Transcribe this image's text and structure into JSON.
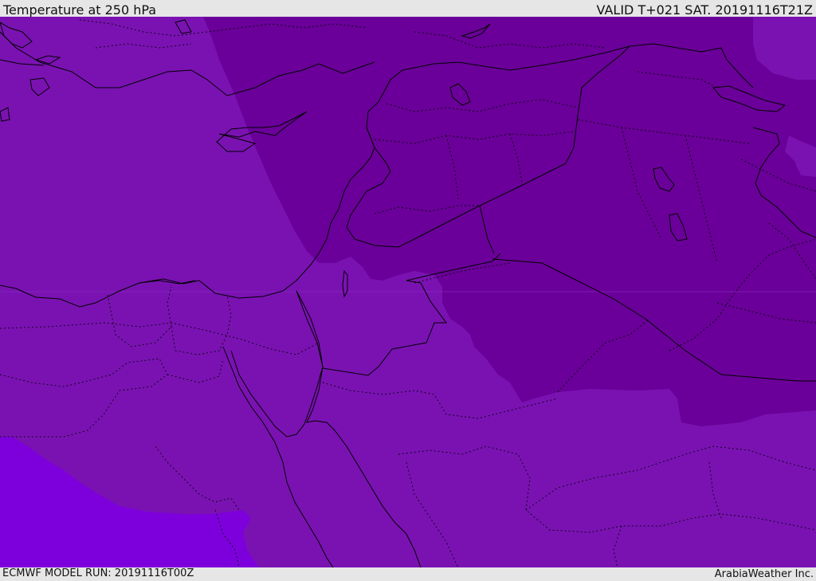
{
  "header": {
    "title": "Temperature at 250 hPa",
    "valid_time": "VALID T+021 SAT. 20191116T21Z"
  },
  "footer": {
    "model_run": "ECMWF MODEL RUN: 20191116T00Z",
    "credit": "ArabiaWeather Inc."
  },
  "map": {
    "field": "Temperature at 250 hPa",
    "colors": {
      "main_band": "#7a12b2",
      "cold_band": "#6a0099",
      "warm_band": "#7d00dc",
      "coastline": "#000000",
      "border": "#000000"
    }
  }
}
